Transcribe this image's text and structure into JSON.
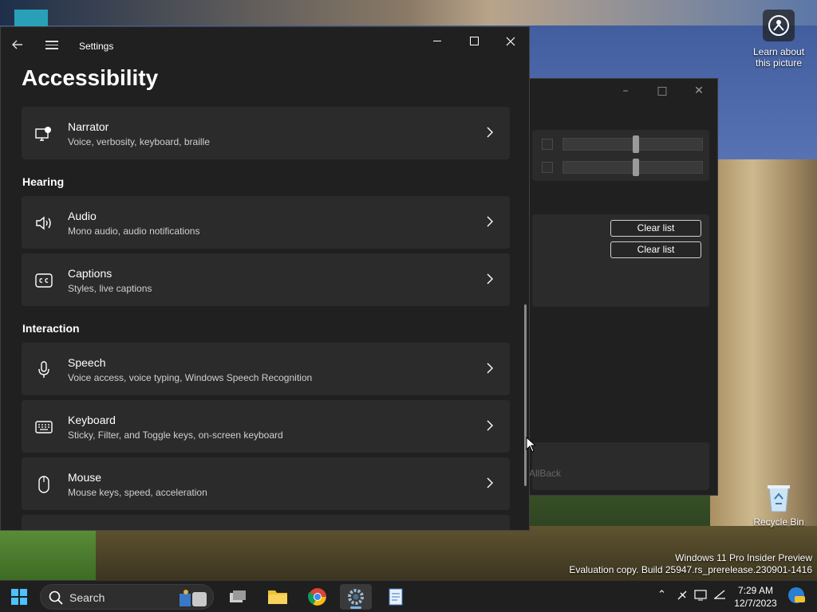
{
  "desktop": {
    "learn_label_line1": "Learn about",
    "learn_label_line2": "this picture",
    "recycle_label": "Recycle Bin",
    "watermark_line1": "Windows 11 Pro Insider Preview",
    "watermark_line2": "Evaluation copy. Build 25947.rs_prerelease.230901-1416"
  },
  "bg_window": {
    "clear_list_1": "Clear list",
    "clear_list_2": "Clear list",
    "partial_text": "AllBack"
  },
  "settings": {
    "window_title": "Settings",
    "page_title": "Accessibility",
    "sections": {
      "hearing": "Hearing",
      "interaction": "Interaction"
    },
    "items": [
      {
        "title": "Narrator",
        "subtitle": "Voice, verbosity, keyboard, braille",
        "icon": "narrator-icon"
      },
      {
        "title": "Audio",
        "subtitle": "Mono audio, audio notifications",
        "icon": "speaker-icon"
      },
      {
        "title": "Captions",
        "subtitle": "Styles, live captions",
        "icon": "captions-icon"
      },
      {
        "title": "Speech",
        "subtitle": "Voice access, voice typing, Windows Speech Recognition",
        "icon": "microphone-icon"
      },
      {
        "title": "Keyboard",
        "subtitle": "Sticky, Filter, and Toggle keys, on-screen keyboard",
        "icon": "keyboard-icon"
      },
      {
        "title": "Mouse",
        "subtitle": "Mouse keys, speed, acceleration",
        "icon": "mouse-icon"
      }
    ]
  },
  "taskbar": {
    "search_label": "Search",
    "apps": [
      "start-icon",
      "task-view-icon",
      "file-explorer-icon",
      "chrome-icon",
      "settings-icon",
      "notepad-icon"
    ],
    "time": "7:29 AM",
    "date": "12/7/2023",
    "accent": "#7ab4e8"
  }
}
